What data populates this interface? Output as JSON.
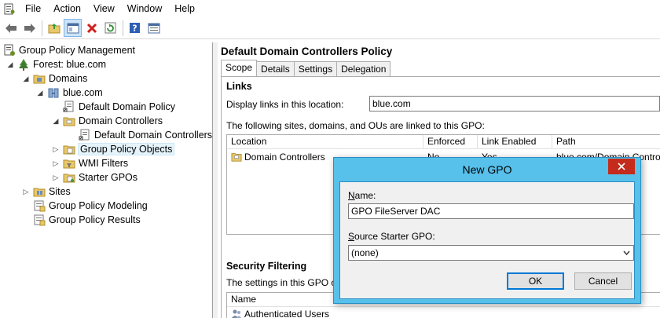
{
  "menu": {
    "items": [
      "File",
      "Action",
      "View",
      "Window",
      "Help"
    ]
  },
  "toolbar": {
    "buttons": [
      "back-icon",
      "forward-icon",
      "up-folder-icon",
      "show-hide-tree-icon",
      "delete-icon",
      "refresh-icon",
      "help-icon",
      "properties-icon"
    ]
  },
  "tree": {
    "root": "Group Policy Management",
    "forest": "Forest: blue.com",
    "domains": "Domains",
    "domain": "blue.com",
    "default_domain_policy": "Default Domain Policy",
    "domain_controllers": "Domain Controllers",
    "default_dc_policy": "Default Domain Controllers I",
    "gpo": "Group Policy Objects",
    "wmi": "WMI Filters",
    "starter": "Starter GPOs",
    "sites": "Sites",
    "modeling": "Group Policy Modeling",
    "results": "Group Policy Results"
  },
  "right": {
    "title": "Default Domain Controllers Policy",
    "tabs": [
      "Scope",
      "Details",
      "Settings",
      "Delegation"
    ],
    "links_head": "Links",
    "display_links_label": "Display links in this location:",
    "display_links_value": "blue.com",
    "linked_text": "The following sites, domains, and OUs are linked to this GPO:",
    "links_columns": [
      "Location",
      "Enforced",
      "Link Enabled",
      "Path"
    ],
    "links_row": {
      "location": "Domain Controllers",
      "enforced": "No",
      "link_enabled": "Yes",
      "path": "blue.com/Domain Controllers"
    },
    "security_head": "Security Filtering",
    "security_text": "The settings in this GPO can",
    "security_columns": [
      "Name"
    ],
    "security_row": "Authenticated Users"
  },
  "dialog": {
    "title": "New GPO",
    "name_label_u": "N",
    "name_label_rest": "ame:",
    "name_value": "GPO FileServer DAC",
    "source_label_u": "S",
    "source_label_rest": "ource Starter GPO:",
    "source_value": "(none)",
    "ok": "OK",
    "cancel": "Cancel"
  },
  "colors": {
    "dialog_frame": "#57c0eb",
    "close_button": "#c42b1c",
    "selection": "#e5f3fb"
  }
}
